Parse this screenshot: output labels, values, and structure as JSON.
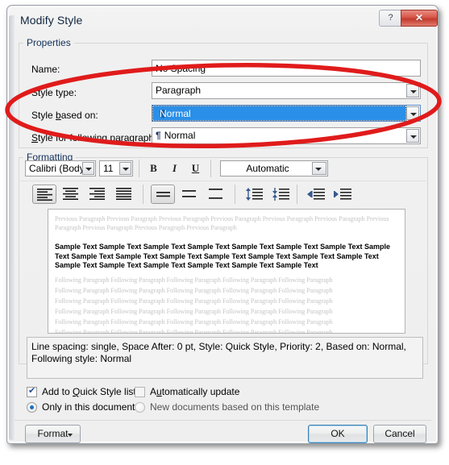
{
  "window": {
    "title": "Modify Style",
    "help_button": "?",
    "close_button": "✕"
  },
  "properties": {
    "group_label": "Properties",
    "name_label": "Name:",
    "name_value": "No Spacing",
    "style_type_label": "Style type:",
    "style_type_value": "Paragraph",
    "style_based_on_label": "Style based on:",
    "style_based_on_value": "Normal",
    "style_following_label": "Style for following paragraph:",
    "style_following_value": "Normal",
    "pilcrow": "¶"
  },
  "formatting": {
    "group_label": "Formatting",
    "font_name": "Calibri (Body)",
    "font_size": "11",
    "bold": "B",
    "italic": "I",
    "underline": "U",
    "font_color": "Automatic",
    "align_left": "align-left",
    "align_center": "align-center",
    "align_right": "align-right",
    "align_justify": "align-justify",
    "line_spacing_single": "line-spacing-single",
    "line_spacing_1_5": "line-spacing-1.5",
    "line_spacing_double": "line-spacing-double",
    "space_before": "remove-space-before",
    "space_after": "add-space-after",
    "decrease_indent": "decrease-indent",
    "increase_indent": "increase-indent"
  },
  "preview": {
    "previous_paragraph": "Previous Paragraph Previous Paragraph Previous Paragraph Previous Paragraph Previous Paragraph Previous Paragraph Previous Paragraph Previous Paragraph Previous Paragraph Previous Paragraph",
    "sample_text": "Sample Text Sample Text Sample Text Sample Text Sample Text Sample Text Sample Text Sample Text Sample Text Sample Text Sample Text Sample Text Sample Text Sample Text Sample Text Sample Text Sample Text Sample Text Sample Text Sample Text Sample Text",
    "following_paragraph": "Following Paragraph Following Paragraph Following Paragraph Following Paragraph Following Paragraph"
  },
  "description": "Line spacing:  single, Space After:  0 pt, Style: Quick Style, Priority: 2, Based on: Normal, Following style: Normal",
  "options": {
    "add_to_quick_style_list": "Add to Quick Style list",
    "add_to_quick_style_list_checked": true,
    "automatically_update": "Automatically update",
    "automatically_update_checked": false,
    "only_in_this_document": "Only in this document",
    "only_in_this_document_selected": true,
    "new_documents_based_on_template": "New documents based on this template",
    "new_documents_selected": false
  },
  "buttons": {
    "format": "Format",
    "ok": "OK",
    "cancel": "Cancel"
  },
  "annotation": {
    "color": "#e01b1b",
    "shape": "ellipse",
    "stroke_width": 5
  }
}
